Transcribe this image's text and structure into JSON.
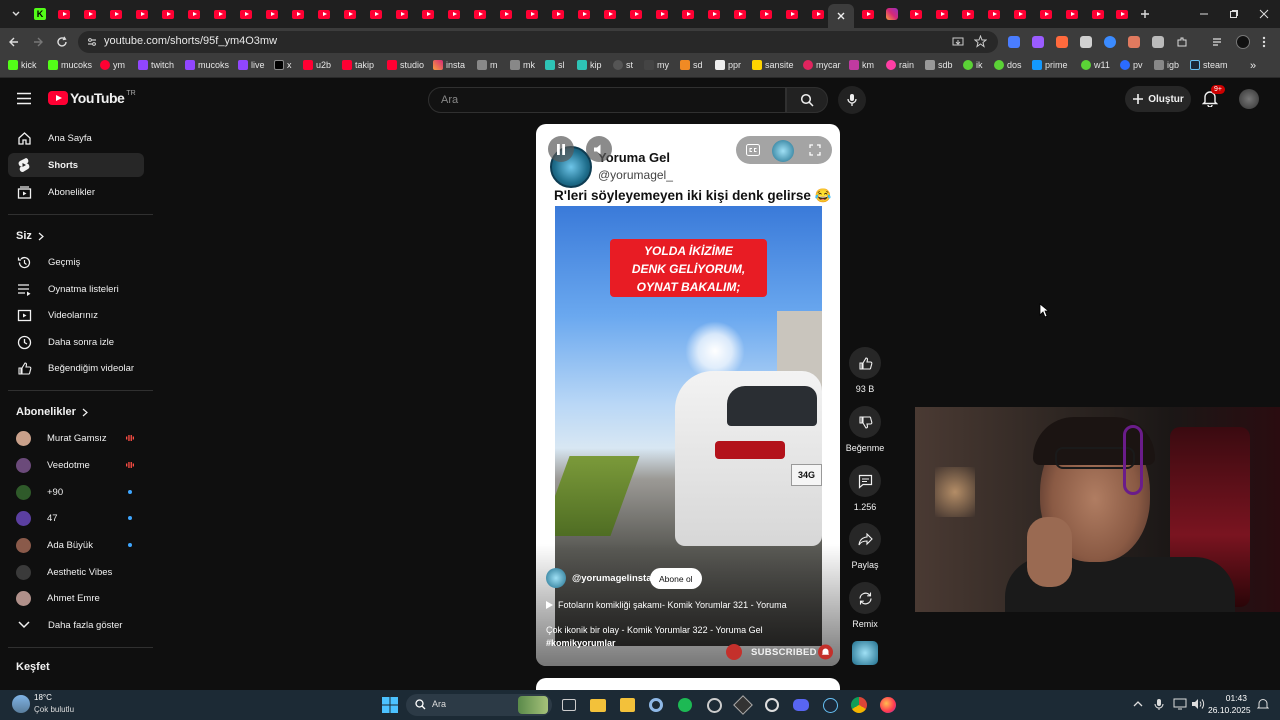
{
  "browser": {
    "url": "youtube.com/shorts/95f_ym4O3mw",
    "bookmarks": [
      "kick",
      "mucoks",
      "ym",
      "twitch",
      "mucoks",
      "live",
      "x",
      "u2b",
      "takip",
      "studio",
      "insta",
      "m",
      "mk",
      "sl",
      "kip",
      "st",
      "my",
      "sd",
      "ppr",
      "sansite",
      "mycar",
      "km",
      "rain",
      "sdb",
      "ik",
      "dos",
      "prime",
      "w11",
      "pv",
      "igb",
      "steam"
    ]
  },
  "youtube": {
    "logo_text": "YouTube",
    "country": "TR",
    "search_placeholder": "Ara",
    "create_label": "Oluştur",
    "notif_count": "9+"
  },
  "sidebar": {
    "main": [
      {
        "label": "Ana Sayfa",
        "icon": "home-icon"
      },
      {
        "label": "Shorts",
        "icon": "shorts-icon"
      },
      {
        "label": "Abonelikler",
        "icon": "subscriptions-icon"
      }
    ],
    "you_title": "Siz",
    "you": [
      {
        "label": "Geçmiş",
        "icon": "history-icon"
      },
      {
        "label": "Oynatma listeleri",
        "icon": "playlist-icon"
      },
      {
        "label": "Videolarınız",
        "icon": "your-videos-icon"
      },
      {
        "label": "Daha sonra izle",
        "icon": "watch-later-icon"
      },
      {
        "label": "Beğendiğim videolar",
        "icon": "liked-icon"
      }
    ],
    "subs_title": "Abonelikler",
    "subs": [
      {
        "label": "Murat Gamsız",
        "status": "live",
        "avatar_color": "#c9a08a"
      },
      {
        "label": "Veedotme",
        "status": "live",
        "avatar_color": "#6b4a7a"
      },
      {
        "label": "+90",
        "status": "new",
        "avatar_color": "#2f5a2a"
      },
      {
        "label": "47",
        "status": "new",
        "avatar_color": "#5b3fa0"
      },
      {
        "label": "Ada Büyük",
        "status": "new",
        "avatar_color": "#8a5a4a"
      },
      {
        "label": "Aesthetic Vibes",
        "status": "",
        "avatar_color": "#3a3a3a"
      },
      {
        "label": "Ahmet Emre",
        "status": "",
        "avatar_color": "#b0908a"
      }
    ],
    "more_label": "Daha fazla göster",
    "explore_title": "Keşfet"
  },
  "short": {
    "channel_name": "Yoruma Gel",
    "channel_handle": "@yorumagel_",
    "caption": "R'leri söyleyemeyen iki kişi denk gelirse 😂",
    "banner_lines": [
      "YOLDA İKİZİME",
      "DENK GELİYORUM,",
      "OYNAT BAKALIM;"
    ],
    "plate": "34G",
    "author": "@yorumagelinsta",
    "subscribe_label": "Abone ol",
    "playlist": "Fotoların komikliği şakamı- Komik Yorumlar 321 - Yoruma",
    "description": "Çok ikonik bir olay - Komik Yorumlar 322 - Yoruma Gel",
    "hashtag": "#komikyorumlar",
    "subscribed_label": "SUBSCRIBED"
  },
  "actions": {
    "likes": "93 B",
    "dislike": "Beğenme",
    "comments": "1.256",
    "share": "Paylaş",
    "remix": "Remix"
  },
  "taskbar": {
    "weather_temp": "18°C",
    "weather_desc": "Çok bulutlu",
    "search_label": "Ara",
    "time": "01:43",
    "date": "26.10.2025"
  },
  "colors": {
    "accent_red": "#ff0033",
    "bg": "#0f0f0f",
    "link_blue": "#3ea6ff"
  }
}
